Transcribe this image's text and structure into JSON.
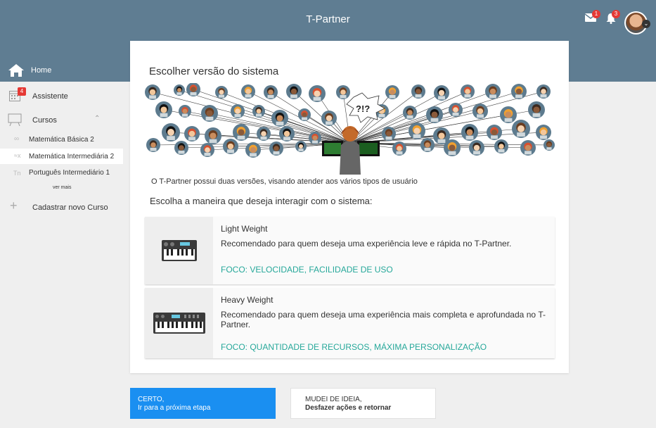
{
  "header": {
    "title": "T-Partner",
    "mail_badge": "1",
    "notifications_badge": "3",
    "bg_color": "#5f7d92"
  },
  "sidebar": {
    "home_label": "Home",
    "assistant_label": "Assistente",
    "assistant_badge": "4",
    "courses_label": "Cursos",
    "courses": [
      {
        "abbr": "∞",
        "label": "Matemática Básica 2"
      },
      {
        "abbr": "≈x",
        "label": "Matemática Intermediária 2"
      },
      {
        "abbr": "Tn",
        "label": "Português Intermediário 1"
      }
    ],
    "see_more": "ver mais",
    "new_course_label": "Cadastrar novo Curso"
  },
  "panel": {
    "title": "Escolher versão do sistema",
    "description": "O T-Partner possui duas versões, visando atender aos vários tipos de usuário",
    "question": "Escolha a maneira que deseja interagir com o sistema:",
    "speech": "?!?",
    "options": [
      {
        "name": "Light Weight",
        "text": "Recomendado para quem deseja uma experiência leve e rápida no T-Partner.",
        "focus": "FOCO: VELOCIDADE, FACILIDADE DE USO",
        "icon": "small-keyboard-icon"
      },
      {
        "name": "Heavy Weight",
        "text": "Recomendado para quem deseja uma experiência mais completa e aprofundada no T-Partner.",
        "focus": "FOCO: QUANTIDADE DE RECURSOS, MÁXIMA PERSONALIZAÇÃO",
        "icon": "large-keyboard-icon"
      }
    ],
    "accent_color": "#26a89a"
  },
  "actions": {
    "confirm_line1": "CERTO,",
    "confirm_line2": "Ir para a próxima etapa",
    "cancel_line1": "MUDEI DE IDEIA,",
    "cancel_line2": "Desfazer ações e retornar",
    "primary_color": "#1a8ff1"
  }
}
